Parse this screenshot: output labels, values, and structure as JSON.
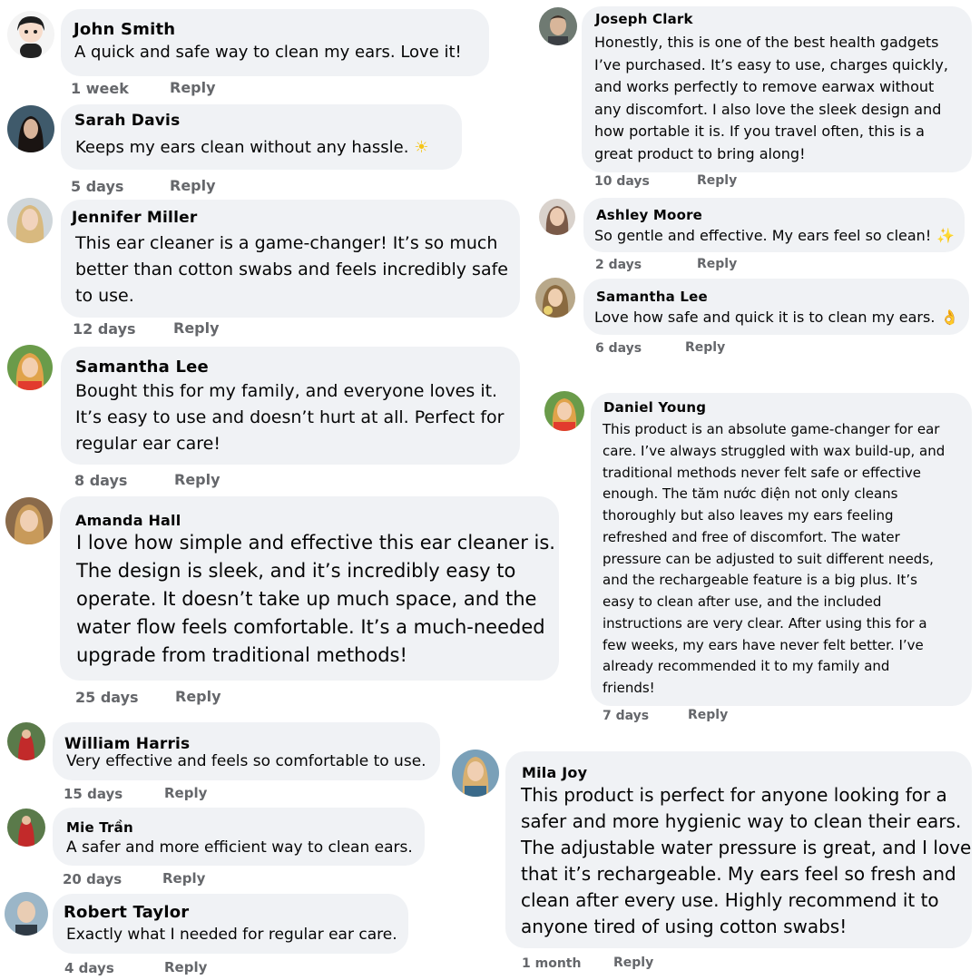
{
  "comments": [
    {
      "name": "John Smith",
      "lines": [
        "A quick and safe way to clean my ears. Love it!"
      ],
      "time": "1 week",
      "reply": "Reply"
    },
    {
      "name": "Sarah Davis",
      "lines": [
        "Keeps my ears clean without any hassle."
      ],
      "time": "5 days",
      "reply": "Reply"
    },
    {
      "name": "Jennifer Miller",
      "lines": [
        "This ear cleaner is a game-changer! It’s so much",
        "better than cotton swabs and feels incredibly safe",
        "to use."
      ],
      "time": "12 days",
      "reply": "Reply"
    },
    {
      "name": "Samantha Lee",
      "lines": [
        "Bought this for my family, and everyone loves it.",
        "It’s easy to use and doesn’t hurt at all. Perfect for",
        "regular ear care!"
      ],
      "time": "8 days",
      "reply": "Reply"
    },
    {
      "name": "Amanda Hall",
      "lines": [
        "I love how simple and effective this ear cleaner is.",
        "The design is sleek, and it’s incredibly easy to",
        "operate. It doesn’t take up much space, and the",
        "water flow feels comfortable. It’s a much-needed",
        "upgrade from traditional methods!"
      ],
      "time": "25 days",
      "reply": "Reply"
    },
    {
      "name": "William Harris",
      "lines": [
        "Very effective and feels so comfortable to use."
      ],
      "time": "15 days",
      "reply": "Reply"
    },
    {
      "name": "Mie Trần",
      "lines": [
        "A safer and more efficient way to clean ears."
      ],
      "time": "20 days",
      "reply": "Reply"
    },
    {
      "name": "Robert Taylor",
      "lines": [
        "Exactly what I needed for regular ear care."
      ],
      "time": "4 days",
      "reply": "Reply"
    },
    {
      "name": "Joseph Clark",
      "lines": [
        "Honestly, this is one of the best health gadgets",
        "I’ve purchased. It’s easy to use, charges quickly,",
        "and works perfectly to remove earwax without",
        "any discomfort. I also love the sleek design and",
        "how portable it is. If you travel often, this is a",
        "great product to bring along!"
      ],
      "time": "10 days",
      "reply": "Reply"
    },
    {
      "name": "Ashley Moore",
      "lines": [
        "So gentle and effective. My ears feel so clean!"
      ],
      "time": "2 days",
      "reply": "Reply"
    },
    {
      "name": "Samantha Lee",
      "lines": [
        "Love how safe and quick it is to clean my ears."
      ],
      "time": "6 days",
      "reply": "Reply"
    },
    {
      "name": "Daniel Young",
      "lines": [
        "This product is an absolute game-changer for ear",
        "care. I’ve always struggled with wax build-up, and",
        "traditional methods never felt safe or effective",
        "enough. The tăm nước điện not only cleans",
        "thoroughly but also leaves my ears feeling",
        "refreshed and free of discomfort. The water",
        "pressure can be adjusted to suit different needs,",
        "and the rechargeable feature is a big plus. It’s",
        "easy to clean after use, and the included",
        "instructions are very clear. After using this for a",
        "few weeks, my ears have never felt better. I’ve",
        "already recommended it to my family and",
        "friends!"
      ],
      "time": "7 days",
      "reply": "Reply"
    },
    {
      "name": "Mila Joy",
      "lines": [
        "This product is perfect for anyone looking for a",
        "safer and more hygienic way to clean their ears.",
        "The adjustable water pressure is great, and I love",
        "that it’s rechargeable. My ears feel so fresh and",
        "clean after every use. Highly recommend it to",
        "anyone tired of using cotton swabs!"
      ],
      "time": "1 month",
      "reply": "Reply"
    }
  ],
  "emoji": {
    "sun": "☀",
    "sparkles": "✨",
    "ok_hand": "👌"
  },
  "colors": {
    "bubble": "#f0f2f5",
    "meta": "#65676b",
    "text": "#050505"
  }
}
